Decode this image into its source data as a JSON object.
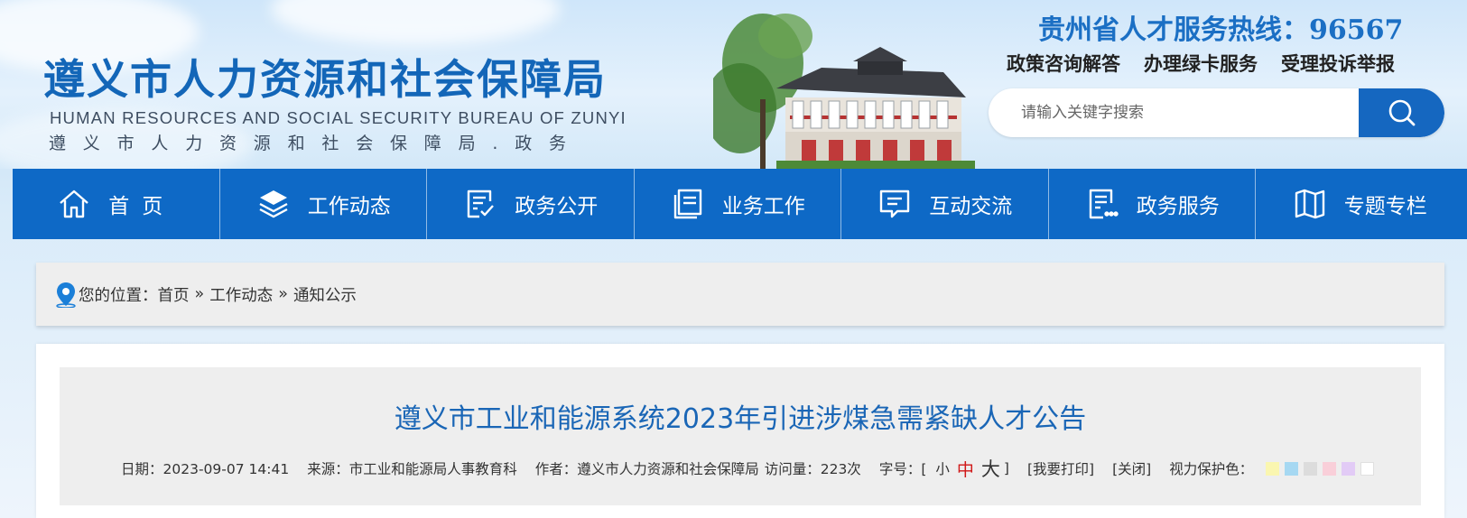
{
  "header": {
    "title_cn": "遵义市人力资源和社会保障局",
    "title_en": "HUMAN RESOURCES AND SOCIAL SECURITY BUREAU OF ZUNYI",
    "title_sub": "遵义市人力资源和社会保障局.政务",
    "hotline": "贵州省人才服务热线：96567",
    "services": [
      "政策咨询解答",
      "办理绿卡服务",
      "受理投诉举报"
    ],
    "search_placeholder": "请输入关键字搜索"
  },
  "nav": {
    "items": [
      {
        "label": "首页",
        "icon": "home-icon"
      },
      {
        "label": "工作动态",
        "icon": "layers-icon"
      },
      {
        "label": "政务公开",
        "icon": "document-check-icon"
      },
      {
        "label": "业务工作",
        "icon": "book-icon"
      },
      {
        "label": "互动交流",
        "icon": "chat-icon"
      },
      {
        "label": "政务服务",
        "icon": "list-document-icon"
      },
      {
        "label": "专题专栏",
        "icon": "map-icon"
      }
    ]
  },
  "breadcrumb": {
    "prefix": "您的位置：",
    "items": [
      "首页",
      "工作动态",
      "通知公示"
    ],
    "separator": "»"
  },
  "article": {
    "title": "遵义市工业和能源系统2023年引进涉煤急需紧缺人才公告",
    "date": "日期：2023-09-07 14:41",
    "source": "来源：市工业和能源局人事教育科",
    "author": "作者：遵义市人力资源和社会保障局",
    "views": "访问量：223次",
    "font_size_label": "字号：[",
    "font_small": "小",
    "font_medium": "中",
    "font_large": "大",
    "font_close": "]",
    "print": "[我要打印]",
    "close": "[关闭]",
    "eye_protect_label": "视力保护色：",
    "eye_colors": [
      "#faf6b0",
      "#a6d8f2",
      "#dcdcdc",
      "#f9cfd9",
      "#e2cbf6",
      "#ffffff"
    ]
  },
  "colors": {
    "primary": "#0e69c6",
    "title_blue": "#1a66b6",
    "font_mid_red": "#d01818"
  }
}
